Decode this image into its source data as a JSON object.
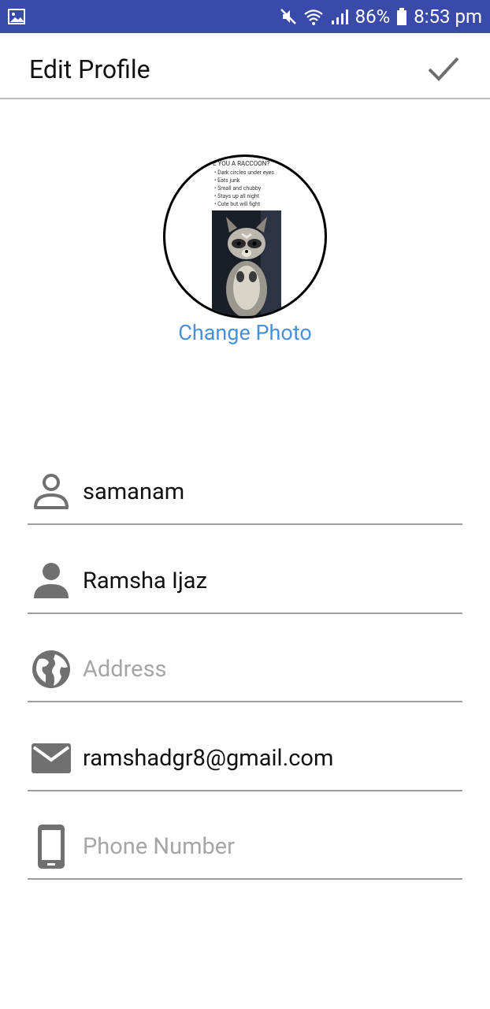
{
  "status_bar": {
    "battery": "86%",
    "time": "8:53 pm",
    "icons": [
      "image-icon",
      "mute-icon",
      "wifi-icon",
      "signal-icon",
      "battery-icon"
    ]
  },
  "toolbar": {
    "title": "Edit Profile",
    "confirm_icon": "check-icon"
  },
  "avatar": {
    "meme_title": "E YOU A RACCOON?",
    "meme_items": [
      "• Dark circles under eyes",
      "• Eats junk",
      "• Small and chubby",
      "• Stays up all night",
      "• Cute but will fight"
    ],
    "change_photo_label": "Change Photo"
  },
  "form": {
    "username": {
      "value": "samanam",
      "icon": "person-outline-icon"
    },
    "full_name": {
      "value": "Ramsha Ijaz",
      "icon": "person-icon"
    },
    "address": {
      "placeholder": "Address",
      "icon": "globe-icon"
    },
    "email": {
      "value": "ramshadgr8@gmail.com",
      "icon": "email-icon"
    },
    "phone": {
      "placeholder": "Phone Number",
      "icon": "phone-icon"
    }
  },
  "colors": {
    "status_bar": "#3a4aa9",
    "link": "#4a90d9",
    "icon_gray": "#707070",
    "placeholder": "#a6a6a6"
  }
}
